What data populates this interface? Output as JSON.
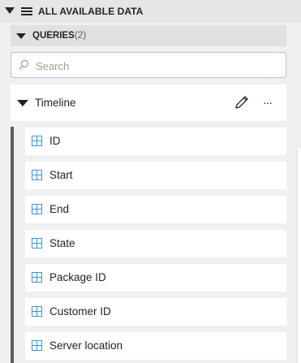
{
  "header": {
    "title": "ALL AVAILABLE DATA",
    "collapse_icon": "caret-down-icon",
    "menu_icon": "hamburger-icon"
  },
  "queries": {
    "label": "QUERIES",
    "count": "(2)"
  },
  "search": {
    "placeholder": "Search",
    "value": ""
  },
  "timeline": {
    "label": "Timeline",
    "edit_icon": "pencil-icon",
    "more_label": "···"
  },
  "fields": [
    {
      "label": "ID"
    },
    {
      "label": "Start"
    },
    {
      "label": "End"
    },
    {
      "label": "State"
    },
    {
      "label": "Package ID"
    },
    {
      "label": "Customer ID"
    },
    {
      "label": "Server location"
    }
  ],
  "colors": {
    "accent_border": "#c8b8e8",
    "field_icon": "#3a96dd",
    "background": "#f0f0f0"
  }
}
